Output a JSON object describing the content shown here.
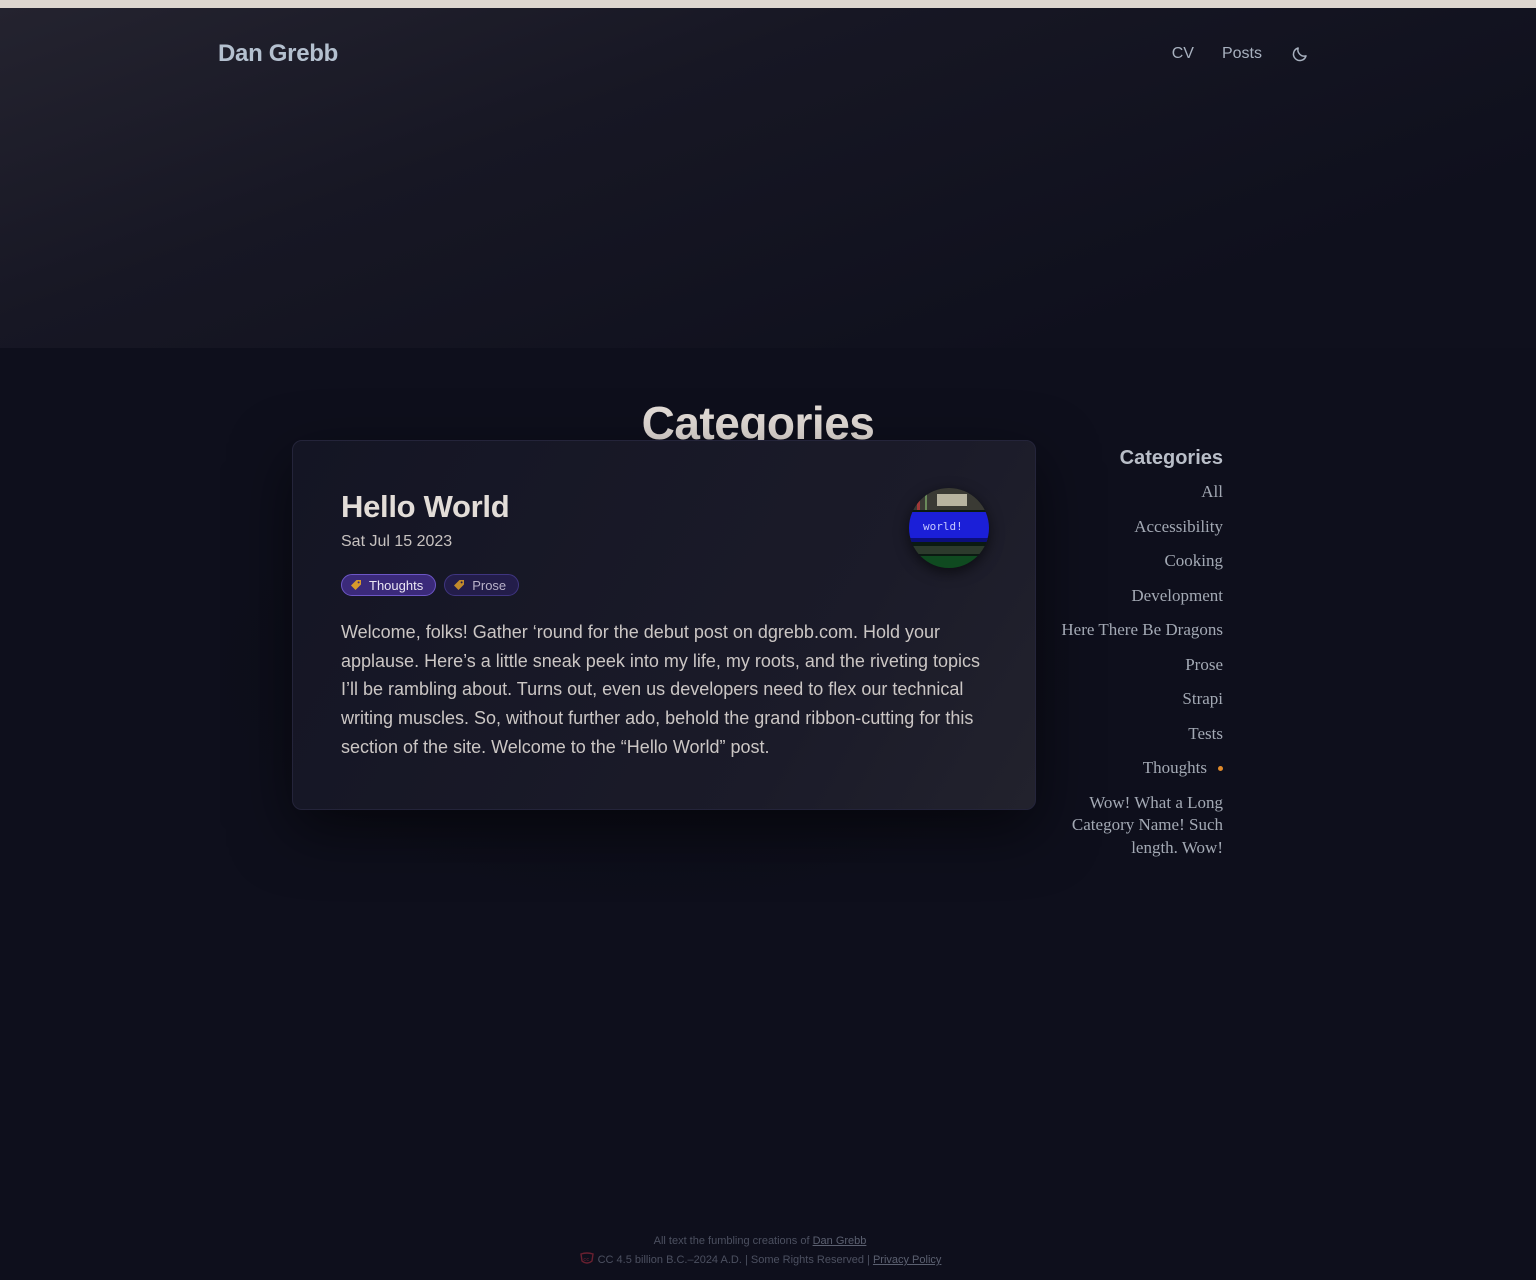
{
  "header": {
    "site_title": "Dan Grebb",
    "nav": [
      {
        "label": "CV"
      },
      {
        "label": "Posts"
      }
    ],
    "theme_toggle_icon": "moon-icon"
  },
  "page": {
    "title": "Categories"
  },
  "post": {
    "title": "Hello World",
    "date": "Sat Jul 15 2023",
    "tags": [
      {
        "label": "Thoughts",
        "icon": "tag-icon",
        "active": true
      },
      {
        "label": "Prose",
        "icon": "tag-icon",
        "active": false
      }
    ],
    "excerpt": "Welcome, folks! Gather ‘round for the debut post on dgrebb.com. Hold your applause. Here’s a little sneak peek into my life, my roots, and the riveting topics I’ll be rambling about. Turns out, even us developers need to flex our technical writing muscles. So, without further ado, behold the grand ribbon-cutting for this section of the site. Welcome to the “Hello World” post.",
    "thumbnail_text": "world!"
  },
  "sidebar": {
    "heading": "Categories",
    "items": [
      {
        "label": "All"
      },
      {
        "label": "Accessibility"
      },
      {
        "label": "Cooking"
      },
      {
        "label": "Development"
      },
      {
        "label": "Here There Be Dragons"
      },
      {
        "label": "Prose"
      },
      {
        "label": "Strapi"
      },
      {
        "label": "Tests"
      },
      {
        "label": "Thoughts",
        "current": true
      },
      {
        "label": "Wow! What a Long Category Name! Such length. Wow!"
      }
    ]
  },
  "footer": {
    "line1_prefix": "All text the fumbling creations of ",
    "line1_link": "Dan Grebb",
    "line2_text": "CC 4.5 billion B.C.–2024 A.D. | Some Rights Reserved | ",
    "line2_link": "Privacy Policy",
    "cc_icon": "creative-commons-icon"
  },
  "colors": {
    "background": "#0e0f1c",
    "accent_tag": "#3b2a7a",
    "current_dot": "#e08a2a"
  }
}
